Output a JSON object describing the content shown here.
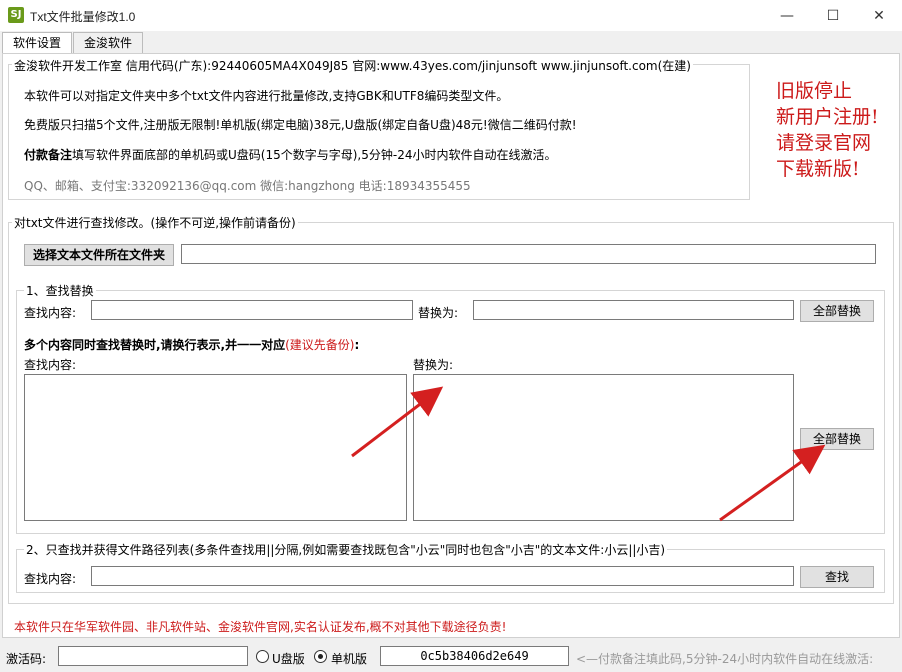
{
  "window": {
    "title": "Txt文件批量修改1.0",
    "minimize": "—",
    "maximize": "☐",
    "close": "✕"
  },
  "tabs": [
    {
      "label": "软件设置",
      "active": true
    },
    {
      "label": "金浚软件",
      "active": false
    }
  ],
  "info": {
    "legend": "金浚软件开发工作室 信用代码(广东):92440605MA4X049J85 官网:www.43yes.com/jinjunsoft  www.jinjunsoft.com(在建)",
    "line1": "本软件可以对指定文件夹中多个txt文件内容进行批量修改,支持GBK和UTF8编码类型文件。",
    "line2": "免费版只扫描5个文件,注册版无限制!单机版(绑定电脑)38元,U盘版(绑定自备U盘)48元!微信二维码付款!",
    "line3_bold": "付款备注",
    "line3_rest": "填写软件界面底部的单机码或U盘码(15个数字与字母),5分钟-24小时内软件自动在线激活。",
    "contact": "QQ、邮箱、支付宝:332092136@qq.com    微信:hangzhong    电话:18934355455",
    "notice": [
      "旧版停止",
      "新用户注册!",
      "请登录官网",
      "下载新版!"
    ]
  },
  "main": {
    "legend": "对txt文件进行查找修改。(操作不可逆,操作前请备份)",
    "choose_folder_button": "选择文本文件所在文件夹",
    "folder_path_value": ""
  },
  "section1": {
    "legend": "1、查找替换",
    "find_label": "查找内容:",
    "find_value": "",
    "replace_label": "替换为:",
    "replace_value": "",
    "replace_all_button": "全部替换",
    "multi_hint_black": "多个内容同时查找替换时,请换行表示,并一一对应",
    "multi_hint_red": "(建议先备份)",
    "multi_hint_colon": ":",
    "multi_find_label": "查找内容:",
    "multi_replace_label": "替换为:",
    "multi_find_value": "",
    "multi_replace_value": "",
    "multi_replace_all_button": "全部替换"
  },
  "section2": {
    "legend": "2、只查找并获得文件路径列表(多条件查找用||分隔,例如需要查找既包含\"小云\"同时也包含\"小吉\"的文本文件:小云||小吉)",
    "find_label": "查找内容:",
    "find_value": "",
    "search_button": "查找"
  },
  "footer": {
    "notice": "本软件只在华军软件园、非凡软件站、金浚软件官网,实名认证发布,概不对其他下载途径负责!",
    "activation_label": "激活码:",
    "activation_value": "",
    "radio_usb": "U盘版",
    "radio_pc": "单机版",
    "machine_code": "0c5b38406d2e649",
    "hint": "<—付款备注填此码,5分钟-24小时内软件自动在线激活:"
  },
  "colors": {
    "red_text": "#cc1a1a",
    "arrow": "#d42020",
    "app_icon": "#6a9a1a"
  }
}
